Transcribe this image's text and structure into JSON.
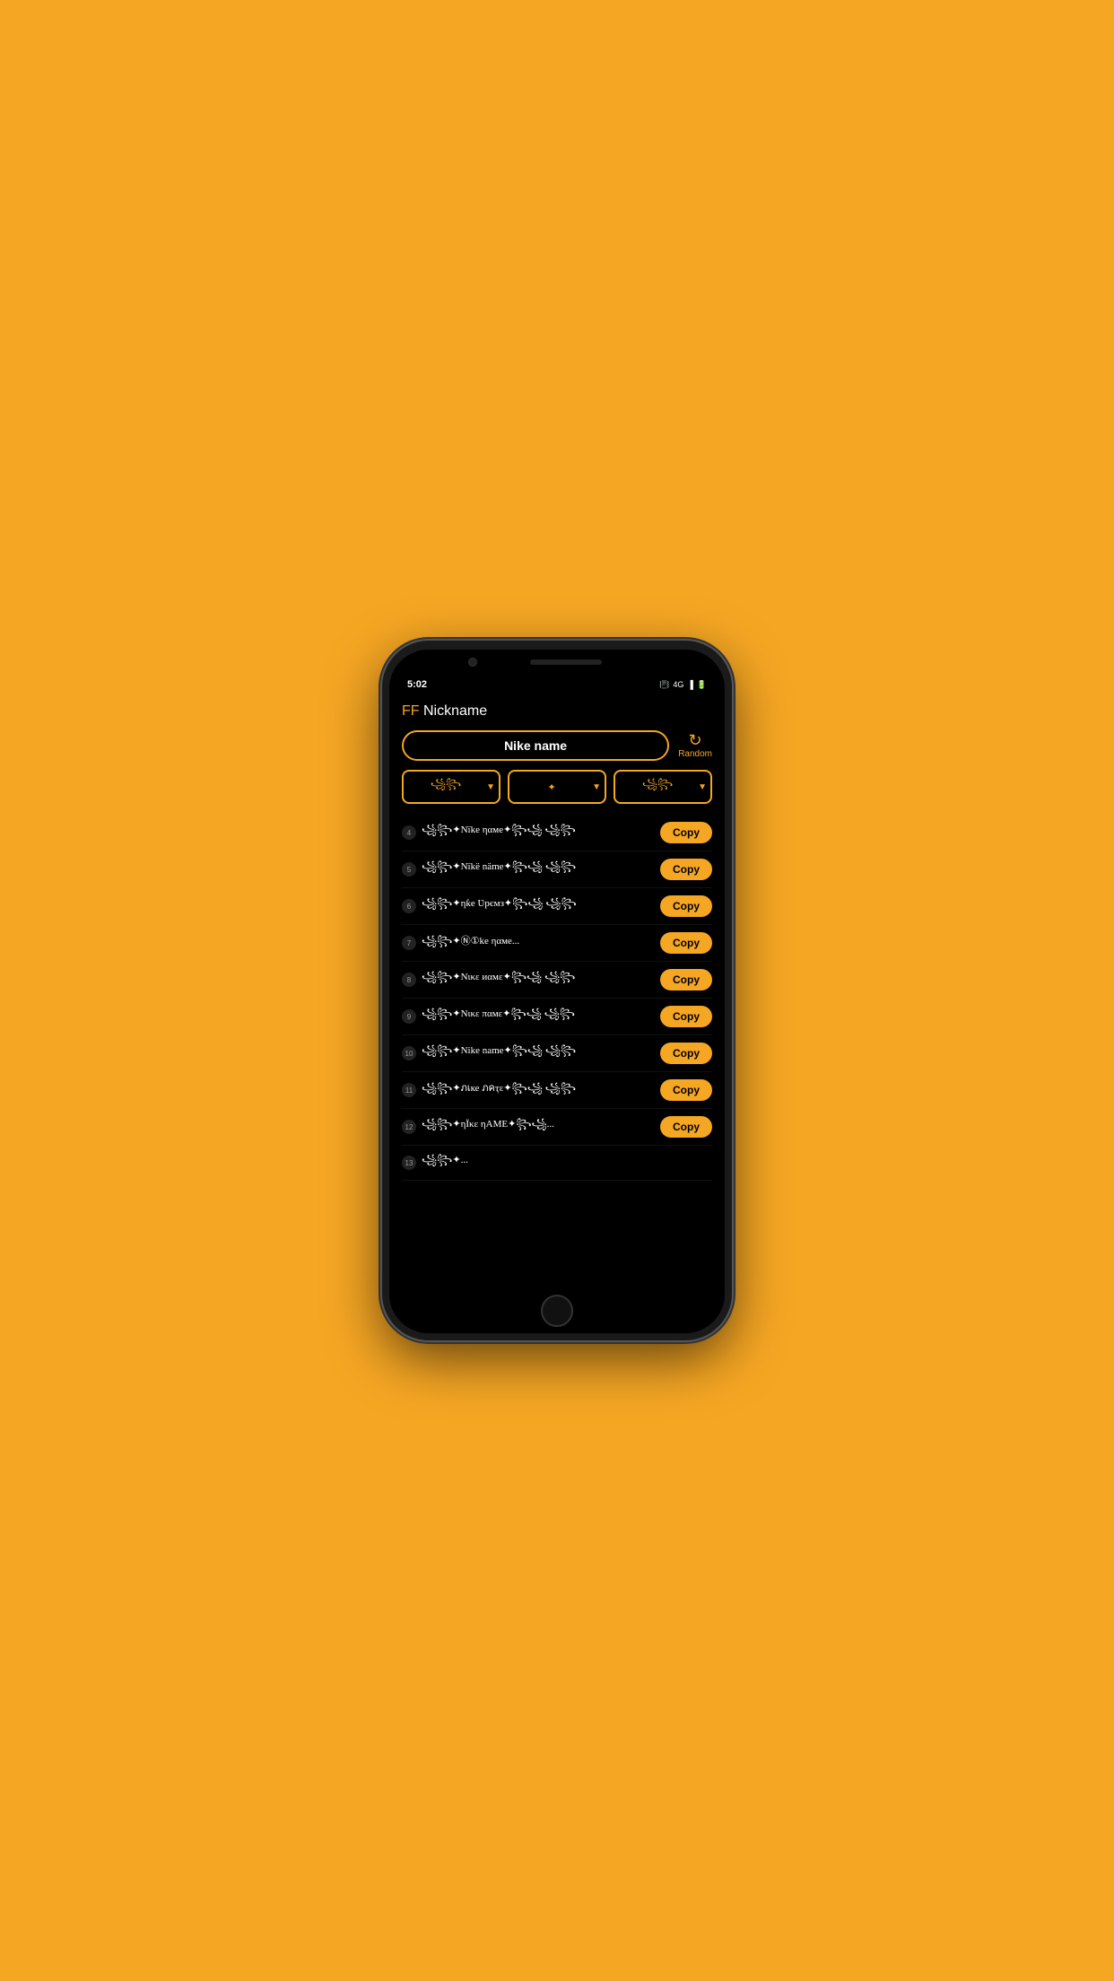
{
  "phone": {
    "status_time": "5:02",
    "status_icons": [
      "📳",
      "4G",
      "📶",
      "🔋"
    ]
  },
  "app": {
    "title_ff": "FF",
    "title_rest": " Nickname",
    "search_value": "Nike name",
    "random_label": "Random",
    "filters": [
      {
        "id": "filter1",
        "text": "꧁꧂",
        "placeholder": "꧁꧂"
      },
      {
        "id": "filter2",
        "text": "✦",
        "placeholder": "✦"
      },
      {
        "id": "filter3",
        "text": "꧁꧂",
        "placeholder": "꧁꧂"
      }
    ],
    "nicknames": [
      {
        "number": "4",
        "text": "꧁꧂✦Nïke ηαмe✦꧂꧁ ꧁꧂"
      },
      {
        "number": "5",
        "text": "꧁꧂✦Nïkë näme✦꧂꧁ ꧁꧂"
      },
      {
        "number": "6",
        "text": "꧁꧂✦ηƙe Ʋрємз✦꧂꧁ ꧁꧂"
      },
      {
        "number": "7",
        "text": "꧁꧂✦Ⓝ①ke ηαмe..."
      },
      {
        "number": "8",
        "text": "꧁꧂✦Nικε иαмε✦꧂꧁ ꧁꧂"
      },
      {
        "number": "9",
        "text": "꧁꧂✦Nικε παмε✦꧂꧁ ꧁꧂"
      },
      {
        "number": "10",
        "text": "꧁꧂✦Nike name✦꧂꧁ ꧁꧂"
      },
      {
        "number": "11",
        "text": "꧁꧂✦ภเке ภคҭε✦꧂꧁ ꧁꧂"
      },
      {
        "number": "12",
        "text": "꧁꧂✦ηΪκε ηΑΜΕ✦꧂꧁..."
      },
      {
        "number": "13",
        "text": "꧁꧂✦..."
      }
    ],
    "copy_label": "Copy"
  }
}
